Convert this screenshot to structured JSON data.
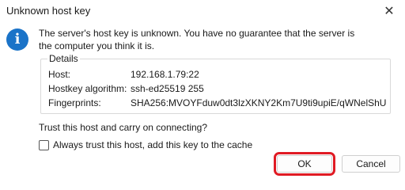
{
  "window": {
    "title": "Unknown host key",
    "close_glyph": "✕"
  },
  "icon": {
    "glyph": "i",
    "color": "#1a73c8"
  },
  "message": {
    "line1": "The server's host key is unknown. You have no guarantee that the server is",
    "line2": "the computer you think it is."
  },
  "details": {
    "legend": "Details",
    "rows": [
      {
        "label": "Host:",
        "value": "192.168.1.79:22"
      },
      {
        "label": "Hostkey algorithm:",
        "value": "ssh-ed25519 255"
      },
      {
        "label": "Fingerprints:",
        "value": "SHA256:MVOYFduw0dt3lzXKNY2Km7U9ti9upiE/qWNelShU"
      }
    ]
  },
  "question": "Trust this host and carry on connecting?",
  "checkbox": {
    "label": "Always trust this host, add this key to the cache",
    "checked": false
  },
  "buttons": {
    "ok": "OK",
    "cancel": "Cancel",
    "highlight_color": "#e01b24"
  }
}
